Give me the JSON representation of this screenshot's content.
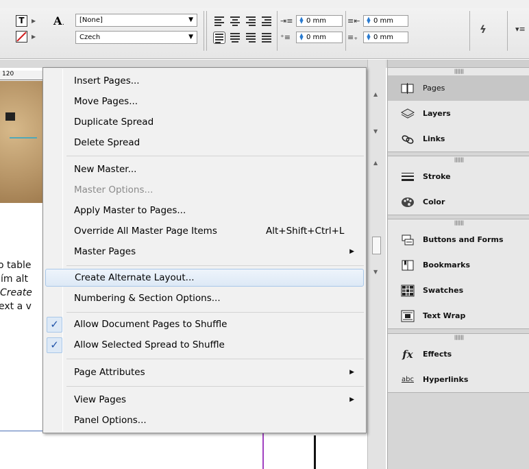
{
  "controlbar": {
    "paragraph_style": "[None]",
    "language": "Czech",
    "left_indent": "0 mm",
    "first_line_indent": "0 mm",
    "right_indent": "0 mm",
    "last_line_indent": "0 mm",
    "char_icon": "A",
    "text_icon": "T"
  },
  "document": {
    "ruler_label": "120",
    "lines": [
      "o table",
      "ím alt",
      "Create",
      "ext a v"
    ]
  },
  "menu": {
    "items": [
      {
        "label": "Insert Pages..."
      },
      {
        "label": "Move Pages..."
      },
      {
        "label": "Duplicate Spread"
      },
      {
        "label": "Delete Spread"
      },
      {
        "label": "New Master..."
      },
      {
        "label": "Master Options...",
        "disabled": true
      },
      {
        "label": "Apply Master to Pages..."
      },
      {
        "label": "Override All Master Page Items",
        "shortcut": "Alt+Shift+Ctrl+L"
      },
      {
        "label": "Master Pages",
        "submenu": true
      },
      {
        "label": "Create Alternate Layout...",
        "highlighted": true
      },
      {
        "label": "Numbering & Section Options..."
      },
      {
        "label": "Allow Document Pages to Shuffle",
        "checked": true
      },
      {
        "label": "Allow Selected Spread to Shuffle",
        "checked": true
      },
      {
        "label": "Page Attributes",
        "submenu": true
      },
      {
        "label": "View Pages",
        "submenu": true
      },
      {
        "label": "Panel Options..."
      }
    ]
  },
  "panel": {
    "groups": [
      {
        "items": [
          {
            "label": "Pages",
            "icon": "pages-icon",
            "active": true
          },
          {
            "label": "Layers",
            "icon": "layers-icon"
          },
          {
            "label": "Links",
            "icon": "links-icon"
          }
        ]
      },
      {
        "items": [
          {
            "label": "Stroke",
            "icon": "stroke-icon"
          },
          {
            "label": "Color",
            "icon": "color-icon"
          }
        ]
      },
      {
        "items": [
          {
            "label": "Buttons and Forms",
            "icon": "buttons-forms-icon"
          },
          {
            "label": "Bookmarks",
            "icon": "bookmarks-icon"
          },
          {
            "label": "Swatches",
            "icon": "swatches-icon"
          },
          {
            "label": "Text Wrap",
            "icon": "text-wrap-icon"
          }
        ]
      },
      {
        "items": [
          {
            "label": "Effects",
            "icon": "effects-icon"
          },
          {
            "label": "Hyperlinks",
            "icon": "hyperlinks-icon"
          }
        ]
      }
    ]
  },
  "colors": {
    "menu_highlight": "#dde9f6",
    "check_color": "#1f52a8",
    "panel_bg": "#d6d6d6"
  }
}
